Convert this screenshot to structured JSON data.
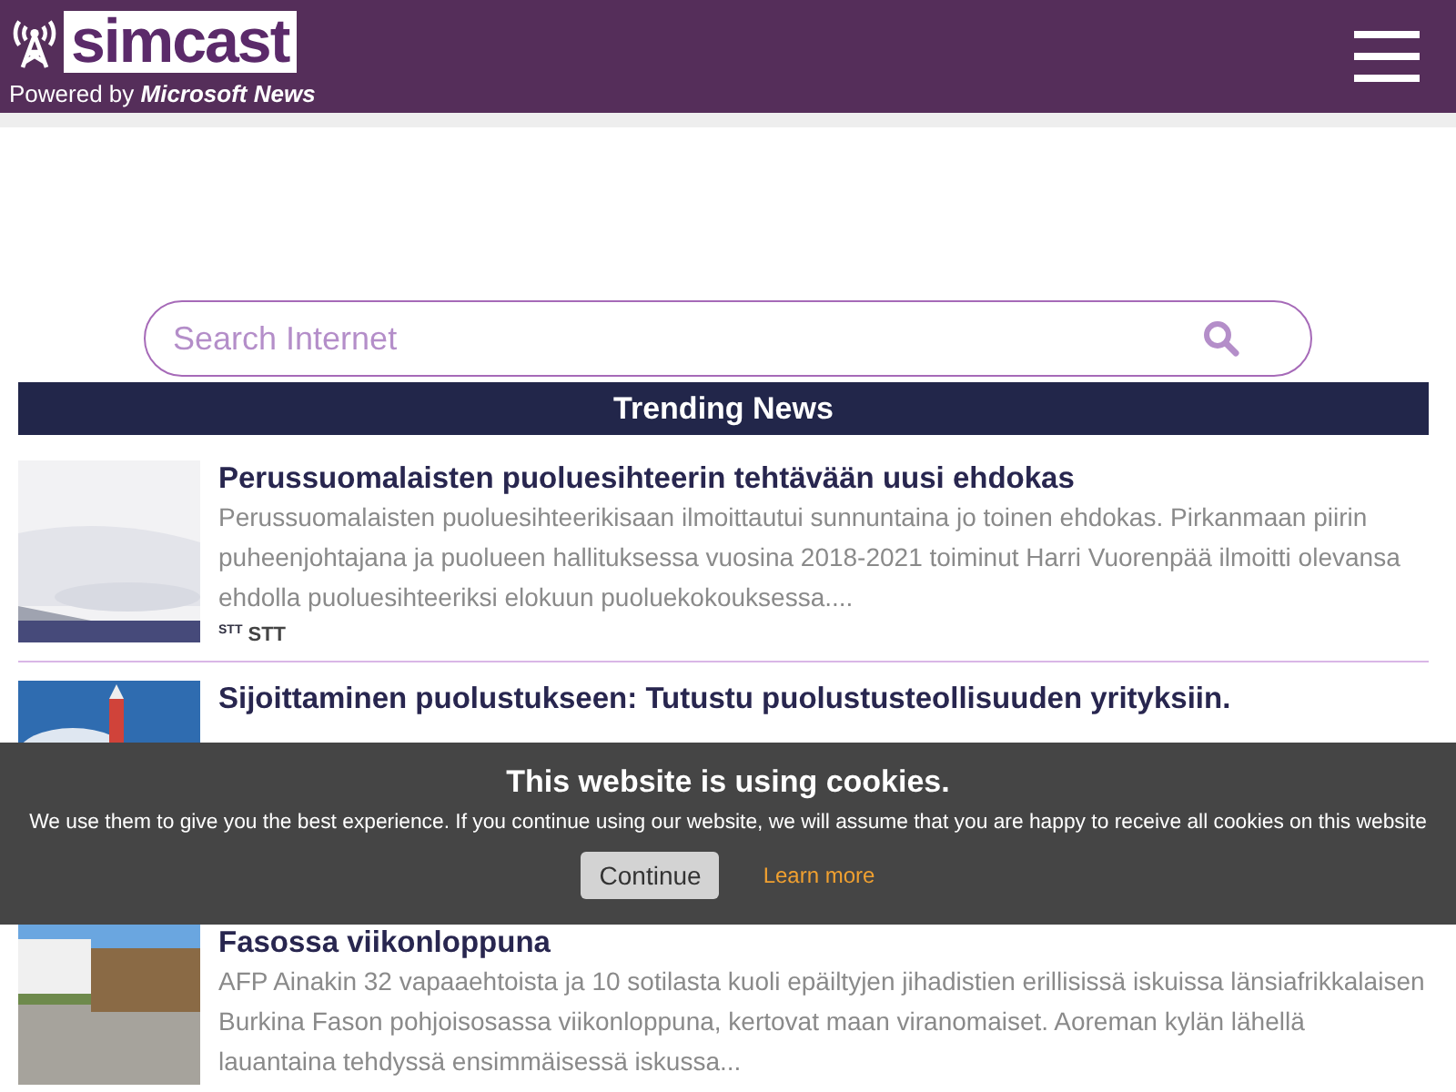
{
  "header": {
    "logo": "simcast",
    "powered_prefix": "Powered by",
    "powered_brand": "Microsoft News"
  },
  "search": {
    "placeholder": "Search Internet"
  },
  "trending": {
    "title": "Trending News"
  },
  "articles": [
    {
      "title": "Perussuomalaisten puoluesihteerin tehtävään uusi ehdokas",
      "summary": "Perussuomalaisten puoluesihteerikisaan ilmoittautui sunnuntaina jo toinen ehdokas. Pirkanmaan piirin puheenjohtajana ja puolueen hallituksessa vuosina 2018-2021 toiminut Harri Vuorenpää ilmoitti olevansa ehdolla puoluesihteeriksi elokuun puoluekokouksessa....",
      "source_logo": "STT",
      "source": "STT",
      "kind": "picture"
    },
    {
      "title": "Sijoittaminen puolustukseen: Tutustu puolustusteollisuuden yrityksiin.",
      "kind": "picture"
    },
    {
      "title": "Fasossa viikonloppuna",
      "summary": "AFP Ainakin 32 vapaaehtoista ja 10 sotilasta kuoli epäiltyjen jihadistien erillisissä iskuissa länsiafrikkalaisen Burkina Fason pohjoisosassa viikonloppuna, kertovat maan viranomaiset. Aoreman kylän lähellä lauantaina tehdyssä ensimmäisessä iskussa...",
      "kind": "picture"
    }
  ],
  "cookie": {
    "title": "This website is using cookies.",
    "text": "We use them to give you the best experience. If you continue using our website, we will assume that you are happy to receive all cookies on this website",
    "continue": "Continue",
    "learn_more": "Learn more"
  }
}
